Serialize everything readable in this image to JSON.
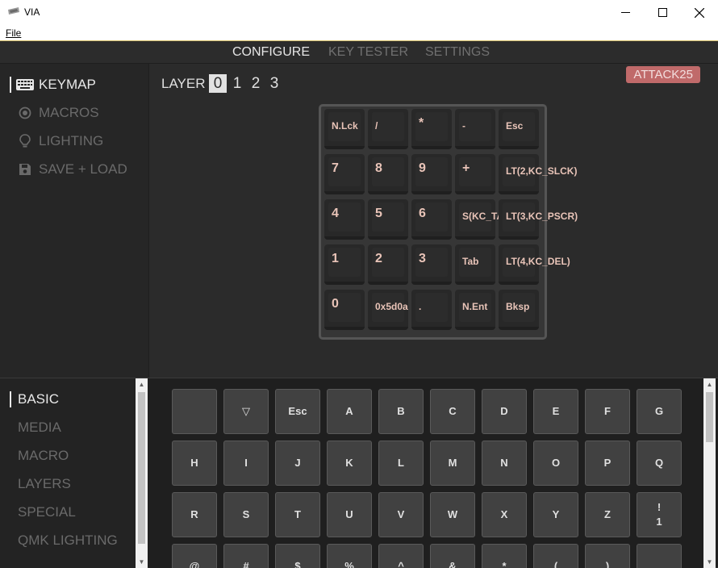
{
  "window": {
    "title": "VIA",
    "controls": {
      "minimize": "—",
      "maximize": "☐",
      "close": "✕"
    }
  },
  "menu": {
    "file": "File"
  },
  "topnav": {
    "configure": "CONFIGURE",
    "key_tester": "KEY TESTER",
    "settings": "SETTINGS"
  },
  "sidebar": {
    "items": [
      {
        "label": "KEYMAP",
        "icon": "keyboard-icon"
      },
      {
        "label": "MACROS",
        "icon": "record-icon"
      },
      {
        "label": "LIGHTING",
        "icon": "lightbulb-icon"
      },
      {
        "label": "SAVE + LOAD",
        "icon": "floppy-icon"
      }
    ]
  },
  "keyboard_name": "ATTACK25",
  "layer": {
    "label": "LAYER",
    "numbers": [
      "0",
      "1",
      "2",
      "3"
    ],
    "selected": "0"
  },
  "keymap": [
    [
      "N.Lck",
      "/",
      "*",
      "-",
      "Esc"
    ],
    [
      "7",
      "8",
      "9",
      "+",
      "LT(2,KC_SLCK)"
    ],
    [
      "4",
      "5",
      "6",
      "S(KC_TAB)",
      "LT(3,KC_PSCR)"
    ],
    [
      "1",
      "2",
      "3",
      "Tab",
      "LT(4,KC_DEL)"
    ],
    [
      "0",
      "0x5d0a",
      ".",
      "N.Ent",
      "Bksp"
    ]
  ],
  "categories": [
    "BASIC",
    "MEDIA",
    "MACRO",
    "LAYERS",
    "SPECIAL",
    "QMK LIGHTING"
  ],
  "keycodes": [
    [
      "",
      "▽",
      "Esc",
      "A",
      "B",
      "C",
      "D",
      "E",
      "F",
      "G"
    ],
    [
      "H",
      "I",
      "J",
      "K",
      "L",
      "M",
      "N",
      "O",
      "P",
      "Q"
    ],
    [
      "R",
      "S",
      "T",
      "U",
      "V",
      "W",
      "X",
      "Y",
      "Z",
      "!\n1"
    ],
    [
      "@",
      "#",
      "$",
      "%",
      "^",
      "&",
      "*",
      "(",
      ")",
      "_"
    ]
  ],
  "colors": {
    "accent_badge": "#c06a6a",
    "key_legend": "#e9c4b8",
    "background": "#2b2b2b"
  }
}
